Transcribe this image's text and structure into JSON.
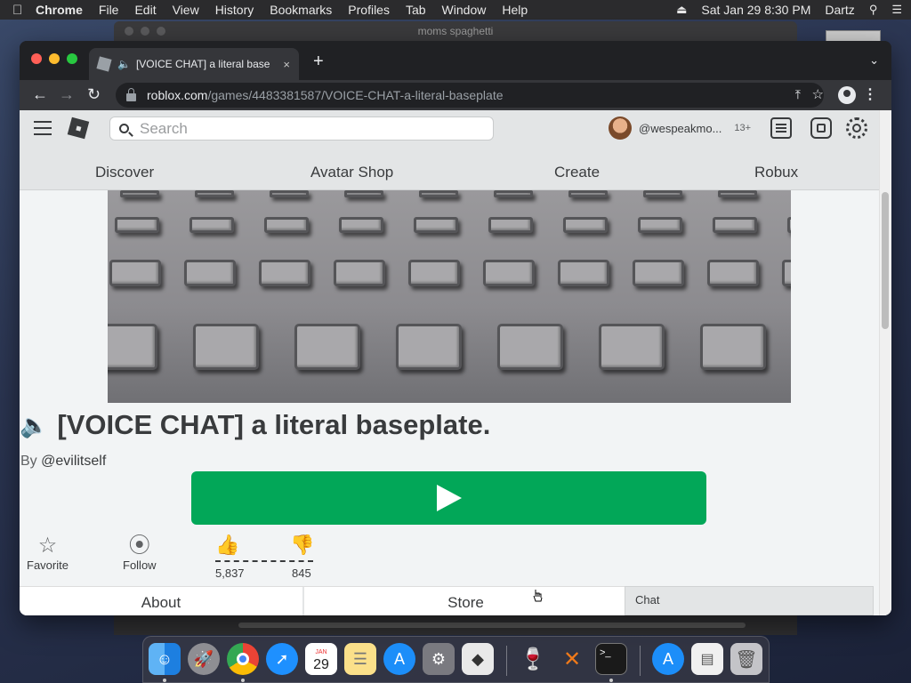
{
  "menubar": {
    "apple": "",
    "app_name": "Chrome",
    "items": [
      "File",
      "Edit",
      "View",
      "History",
      "Bookmarks",
      "Profiles",
      "Tab",
      "Window",
      "Help"
    ],
    "datetime": "Sat Jan 29  8:30 PM",
    "user": "Dartz"
  },
  "background_window": {
    "title": "moms spaghetti"
  },
  "browser": {
    "tab_title": "[VOICE CHAT] a literal base",
    "new_tab": "+",
    "tab_close": "×",
    "url_domain": "roblox.com",
    "url_path": "/games/4483381587/VOICE-CHAT-a-literal-baseplate"
  },
  "site": {
    "search_placeholder": "Search",
    "username": "@wespeakmo...",
    "age_badge": "13+",
    "nav": [
      "Discover",
      "Avatar Shop",
      "Create",
      "Robux"
    ]
  },
  "game": {
    "title": "[VOICE CHAT] a literal baseplate.",
    "by_label": "By",
    "creator": "@evilitself",
    "favorite_label": "Favorite",
    "follow_label": "Follow",
    "upvotes": "5,837",
    "downvotes": "845",
    "tab_about": "About",
    "tab_store": "Store",
    "chat_label": "Chat"
  },
  "dock": {
    "items": [
      "finder-icon",
      "launchpad-icon",
      "chrome-icon",
      "safari-icon",
      "calendar-icon",
      "notes-icon",
      "app-store-icon",
      "system-preferences-icon",
      "roblox-icon",
      "wine-icon",
      "mountain-duck-icon",
      "terminal-icon",
      "app-store-downloads-icon",
      "documents-icon",
      "trash-icon"
    ],
    "calendar_month": "JAN",
    "calendar_day": "29"
  }
}
